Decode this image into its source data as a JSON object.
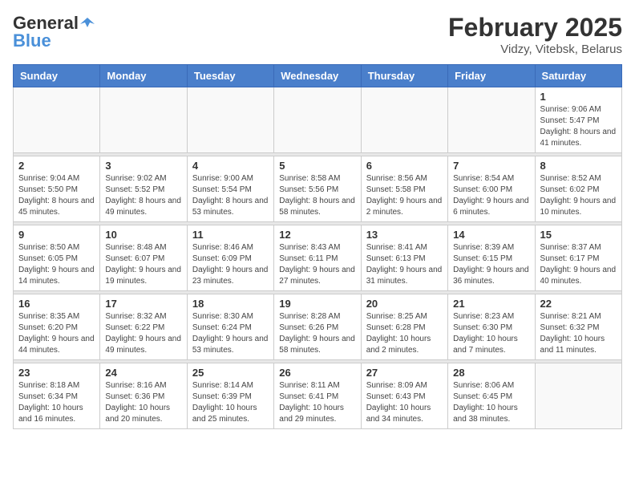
{
  "header": {
    "logo_general": "General",
    "logo_blue": "Blue",
    "month": "February 2025",
    "location": "Vidzy, Vitebsk, Belarus"
  },
  "weekdays": [
    "Sunday",
    "Monday",
    "Tuesday",
    "Wednesday",
    "Thursday",
    "Friday",
    "Saturday"
  ],
  "weeks": [
    [
      {
        "day": "",
        "info": ""
      },
      {
        "day": "",
        "info": ""
      },
      {
        "day": "",
        "info": ""
      },
      {
        "day": "",
        "info": ""
      },
      {
        "day": "",
        "info": ""
      },
      {
        "day": "",
        "info": ""
      },
      {
        "day": "1",
        "info": "Sunrise: 9:06 AM\nSunset: 5:47 PM\nDaylight: 8 hours and 41 minutes."
      }
    ],
    [
      {
        "day": "2",
        "info": "Sunrise: 9:04 AM\nSunset: 5:50 PM\nDaylight: 8 hours and 45 minutes."
      },
      {
        "day": "3",
        "info": "Sunrise: 9:02 AM\nSunset: 5:52 PM\nDaylight: 8 hours and 49 minutes."
      },
      {
        "day": "4",
        "info": "Sunrise: 9:00 AM\nSunset: 5:54 PM\nDaylight: 8 hours and 53 minutes."
      },
      {
        "day": "5",
        "info": "Sunrise: 8:58 AM\nSunset: 5:56 PM\nDaylight: 8 hours and 58 minutes."
      },
      {
        "day": "6",
        "info": "Sunrise: 8:56 AM\nSunset: 5:58 PM\nDaylight: 9 hours and 2 minutes."
      },
      {
        "day": "7",
        "info": "Sunrise: 8:54 AM\nSunset: 6:00 PM\nDaylight: 9 hours and 6 minutes."
      },
      {
        "day": "8",
        "info": "Sunrise: 8:52 AM\nSunset: 6:02 PM\nDaylight: 9 hours and 10 minutes."
      }
    ],
    [
      {
        "day": "9",
        "info": "Sunrise: 8:50 AM\nSunset: 6:05 PM\nDaylight: 9 hours and 14 minutes."
      },
      {
        "day": "10",
        "info": "Sunrise: 8:48 AM\nSunset: 6:07 PM\nDaylight: 9 hours and 19 minutes."
      },
      {
        "day": "11",
        "info": "Sunrise: 8:46 AM\nSunset: 6:09 PM\nDaylight: 9 hours and 23 minutes."
      },
      {
        "day": "12",
        "info": "Sunrise: 8:43 AM\nSunset: 6:11 PM\nDaylight: 9 hours and 27 minutes."
      },
      {
        "day": "13",
        "info": "Sunrise: 8:41 AM\nSunset: 6:13 PM\nDaylight: 9 hours and 31 minutes."
      },
      {
        "day": "14",
        "info": "Sunrise: 8:39 AM\nSunset: 6:15 PM\nDaylight: 9 hours and 36 minutes."
      },
      {
        "day": "15",
        "info": "Sunrise: 8:37 AM\nSunset: 6:17 PM\nDaylight: 9 hours and 40 minutes."
      }
    ],
    [
      {
        "day": "16",
        "info": "Sunrise: 8:35 AM\nSunset: 6:20 PM\nDaylight: 9 hours and 44 minutes."
      },
      {
        "day": "17",
        "info": "Sunrise: 8:32 AM\nSunset: 6:22 PM\nDaylight: 9 hours and 49 minutes."
      },
      {
        "day": "18",
        "info": "Sunrise: 8:30 AM\nSunset: 6:24 PM\nDaylight: 9 hours and 53 minutes."
      },
      {
        "day": "19",
        "info": "Sunrise: 8:28 AM\nSunset: 6:26 PM\nDaylight: 9 hours and 58 minutes."
      },
      {
        "day": "20",
        "info": "Sunrise: 8:25 AM\nSunset: 6:28 PM\nDaylight: 10 hours and 2 minutes."
      },
      {
        "day": "21",
        "info": "Sunrise: 8:23 AM\nSunset: 6:30 PM\nDaylight: 10 hours and 7 minutes."
      },
      {
        "day": "22",
        "info": "Sunrise: 8:21 AM\nSunset: 6:32 PM\nDaylight: 10 hours and 11 minutes."
      }
    ],
    [
      {
        "day": "23",
        "info": "Sunrise: 8:18 AM\nSunset: 6:34 PM\nDaylight: 10 hours and 16 minutes."
      },
      {
        "day": "24",
        "info": "Sunrise: 8:16 AM\nSunset: 6:36 PM\nDaylight: 10 hours and 20 minutes."
      },
      {
        "day": "25",
        "info": "Sunrise: 8:14 AM\nSunset: 6:39 PM\nDaylight: 10 hours and 25 minutes."
      },
      {
        "day": "26",
        "info": "Sunrise: 8:11 AM\nSunset: 6:41 PM\nDaylight: 10 hours and 29 minutes."
      },
      {
        "day": "27",
        "info": "Sunrise: 8:09 AM\nSunset: 6:43 PM\nDaylight: 10 hours and 34 minutes."
      },
      {
        "day": "28",
        "info": "Sunrise: 8:06 AM\nSunset: 6:45 PM\nDaylight: 10 hours and 38 minutes."
      },
      {
        "day": "",
        "info": ""
      }
    ]
  ]
}
